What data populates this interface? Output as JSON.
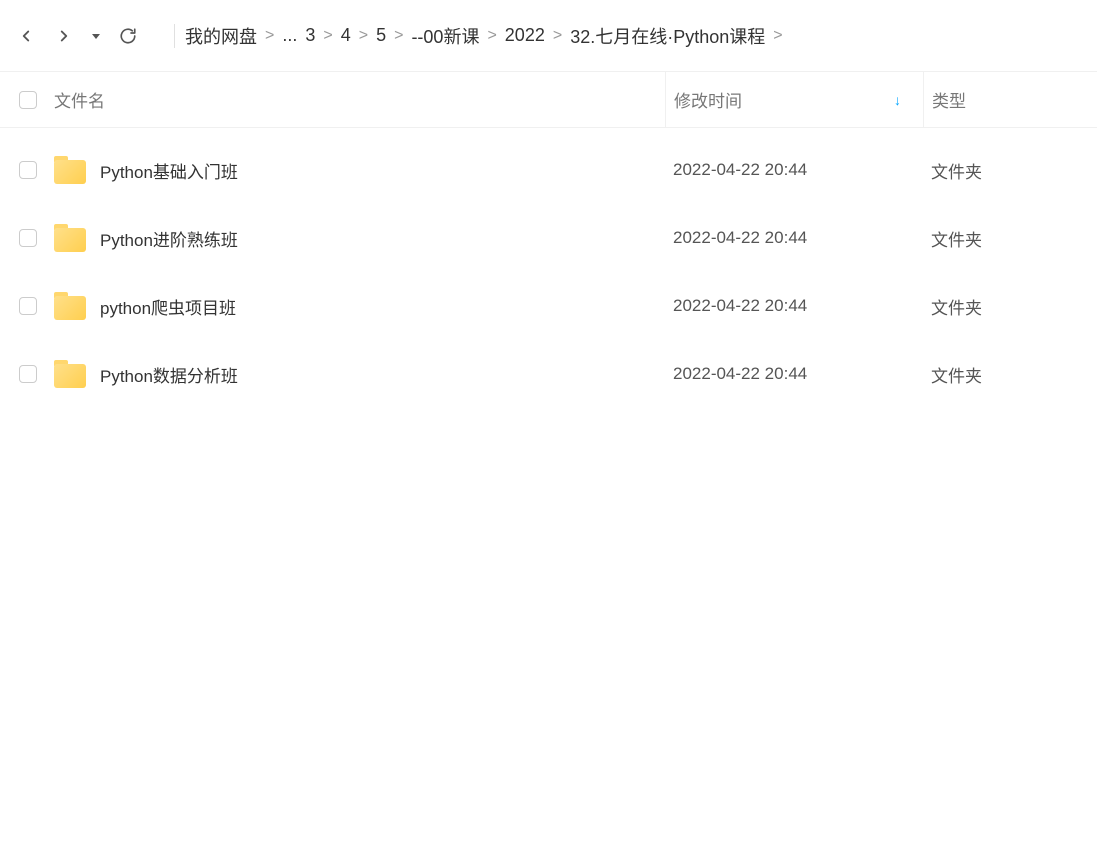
{
  "breadcrumb": {
    "root": "我的网盘",
    "items": [
      "...",
      "3",
      "4",
      "5",
      "--00新课",
      "2022",
      "32.七月在线·Python课程"
    ]
  },
  "columns": {
    "name": "文件名",
    "time": "修改时间",
    "type": "类型"
  },
  "sort": {
    "column": "time",
    "indicator": "↓"
  },
  "files": [
    {
      "name": "Python基础入门班",
      "time": "2022-04-22 20:44",
      "type": "文件夹"
    },
    {
      "name": "Python进阶熟练班",
      "time": "2022-04-22 20:44",
      "type": "文件夹"
    },
    {
      "name": "python爬虫项目班",
      "time": "2022-04-22 20:44",
      "type": "文件夹"
    },
    {
      "name": "Python数据分析班",
      "time": "2022-04-22 20:44",
      "type": "文件夹"
    }
  ]
}
